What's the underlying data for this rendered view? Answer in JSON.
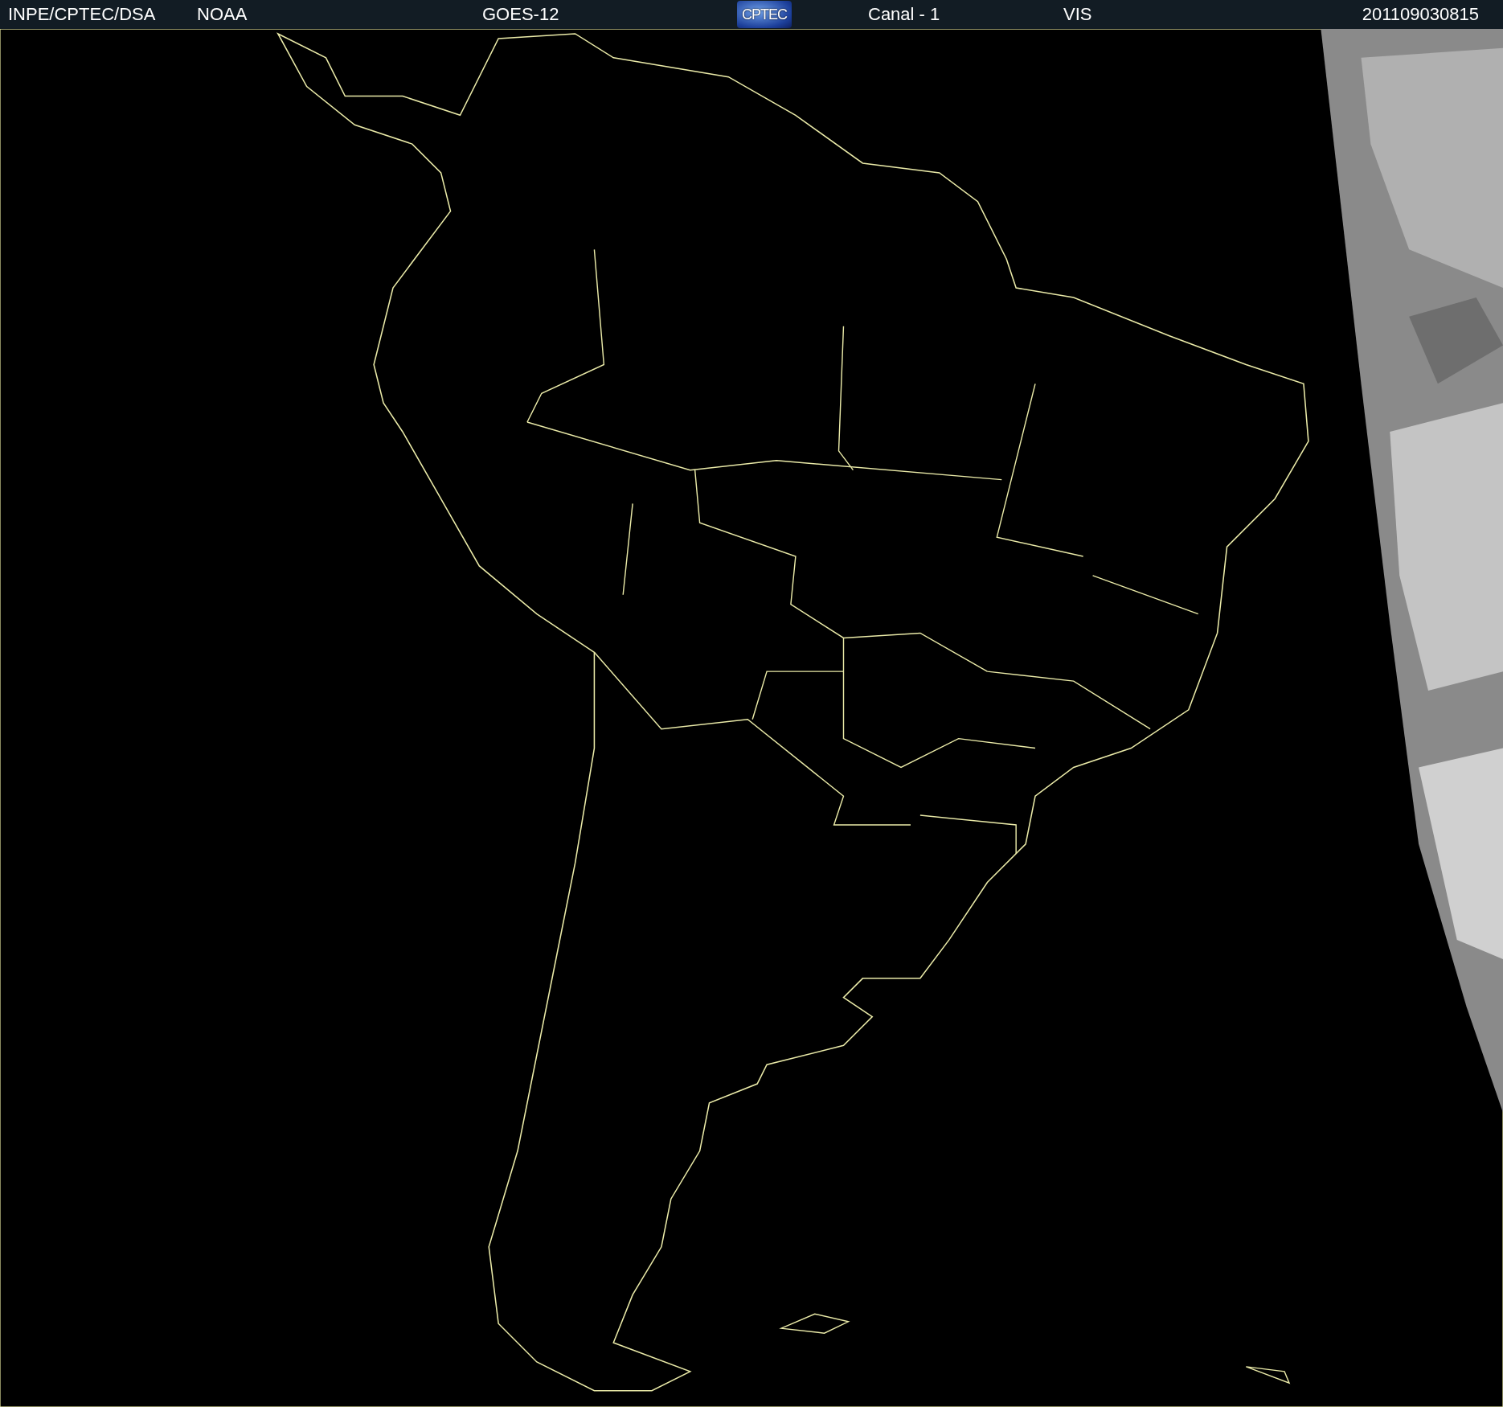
{
  "header": {
    "source": "INPE/CPTEC/DSA",
    "agency": "NOAA",
    "satellite": "GOES-12",
    "logo": "CPTEC",
    "channel": "Canal - 1",
    "band": "VIS",
    "timestamp": "201109030815"
  }
}
